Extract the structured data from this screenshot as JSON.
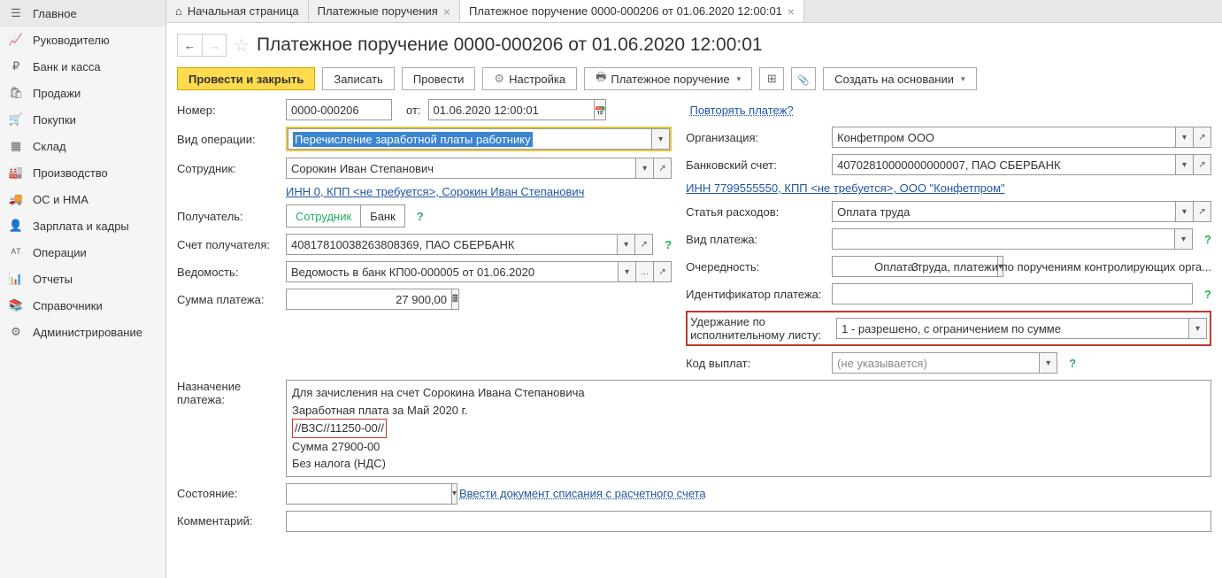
{
  "tabs": [
    {
      "label": "Начальная страница",
      "icon": "home",
      "closable": false
    },
    {
      "label": "Платежные поручения",
      "closable": true
    },
    {
      "label": "Платежное поручение 0000-000206 от 01.06.2020 12:00:01",
      "closable": true,
      "active": true
    }
  ],
  "sidebar": [
    {
      "label": "Главное",
      "icon": "menu"
    },
    {
      "label": "Руководителю",
      "icon": "chart"
    },
    {
      "label": "Банк и касса",
      "icon": "ruble"
    },
    {
      "label": "Продажи",
      "icon": "bag"
    },
    {
      "label": "Покупки",
      "icon": "cart"
    },
    {
      "label": "Склад",
      "icon": "boxes"
    },
    {
      "label": "Производство",
      "icon": "factory"
    },
    {
      "label": "ОС и НМА",
      "icon": "truck"
    },
    {
      "label": "Зарплата и кадры",
      "icon": "person"
    },
    {
      "label": "Операции",
      "icon": "dtkt"
    },
    {
      "label": "Отчеты",
      "icon": "bars"
    },
    {
      "label": "Справочники",
      "icon": "books"
    },
    {
      "label": "Администрирование",
      "icon": "gear"
    }
  ],
  "title": "Платежное поручение 0000-000206 от 01.06.2020 12:00:01",
  "toolbar": {
    "process_close": "Провести и закрыть",
    "save": "Записать",
    "process": "Провести",
    "settings": "Настройка",
    "print": "Платежное поручение",
    "create_based": "Создать на основании"
  },
  "form": {
    "number_label": "Номер:",
    "number": "0000-000206",
    "from": "от:",
    "date": "01.06.2020 12:00:01",
    "repeat_link": "Повторять платеж?",
    "operation_label": "Вид операции:",
    "operation": "Перечисление заработной платы работнику",
    "org_label": "Организация:",
    "org": "Конфетпром ООО",
    "employee_label": "Сотрудник:",
    "employee": "Сорокин Иван Степанович",
    "bank_account_label": "Банковский счет:",
    "bank_account": "40702810000000000007, ПАО СБЕРБАНК",
    "inn_link_left": "ИНН 0, КПП <не требуется>, Сорокин Иван Степанович",
    "inn_link_right": "ИНН 7799555550, КПП <не требуется>, ООО \"Конфетпром\"",
    "recipient_label": "Получатель:",
    "recipient_toggle": [
      "Сотрудник",
      "Банк"
    ],
    "expense_label": "Статья расходов:",
    "expense": "Оплата труда",
    "recipient_account_label": "Счет получателя:",
    "recipient_account": "40817810038263808369, ПАО СБЕРБАНК",
    "payment_type_label": "Вид платежа:",
    "payment_type": "",
    "sheet_label": "Ведомость:",
    "sheet": "Ведомость в банк КП00-000005 от 01.06.2020",
    "order_label": "Очередность:",
    "order": "3",
    "order_text": "Оплата труда, платежи по поручениям контролирующих орга...",
    "amount_label": "Сумма платежа:",
    "amount": "27 900,00",
    "identifier_label": "Идентификатор платежа:",
    "identifier": "",
    "withholding_label": "Удержание по исполнительному листу:",
    "withholding": "1 - разрешено, с ограничением по сумме",
    "payout_code_label": "Код выплат:",
    "payout_code": "(не указывается)",
    "purpose_label": "Назначение платежа:",
    "purpose_line1": "Для зачисления на счет Сорокина Ивана Степановича",
    "purpose_line2": "Заработная плата за Май 2020 г.",
    "purpose_line3": "//ВЗС//11250-00//",
    "purpose_line4": "Сумма 27900-00",
    "purpose_line5": "Без налога (НДС)",
    "status_label": "Состояние:",
    "status": "",
    "status_link": "Ввести документ списания с расчетного счета",
    "comment_label": "Комментарий:"
  }
}
